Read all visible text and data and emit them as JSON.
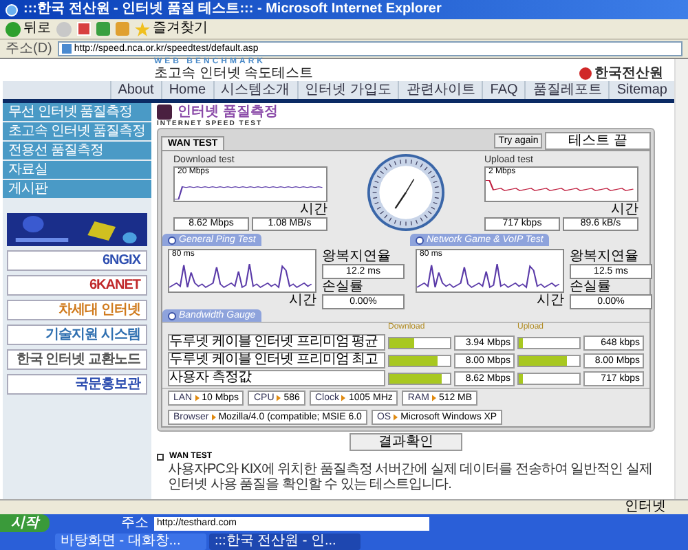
{
  "window": {
    "title": ":::한국 전산원 - 인터넷 품질 테스트::: - Microsoft Internet Explorer"
  },
  "toolbar": {
    "back": "뒤로",
    "favorites": "즐겨찾기"
  },
  "address_bar": {
    "label": "주소(D)",
    "url": "http://speed.nca.or.kr/speedtest/default.asp"
  },
  "site_header": {
    "tagline": "WEB BENCHMARK",
    "title": "초고속 인터넷 속도테스트",
    "logo": "한국전산원"
  },
  "nav": [
    "About",
    "Home",
    "시스템소개",
    "인터넷 가입도",
    "관련사이트",
    "FAQ",
    "품질레포트",
    "Sitemap"
  ],
  "sidebar": {
    "menu": [
      "무선 인터넷 품질측정",
      "초고속 인터넷 품질측정",
      "전용선 품질측정",
      "자료실",
      "게시판"
    ],
    "banners": [
      {
        "kind": "picture"
      },
      {
        "kind": "text",
        "label": "6NGIX",
        "color": "#2f4fb0"
      },
      {
        "kind": "text",
        "label": "6KANET",
        "color": "#c0282a"
      },
      {
        "kind": "text",
        "label": "차세대 인터넷",
        "color": "#d07a1c"
      },
      {
        "kind": "text",
        "label": "기술지원 시스템",
        "color": "#2f6fb0"
      },
      {
        "kind": "text",
        "label": "한국 인터넷 교환노드",
        "color": "#555555"
      },
      {
        "kind": "text",
        "label": "국문홍보관",
        "color": "#2f4fb0"
      }
    ]
  },
  "main": {
    "title": "인터넷 품질측정",
    "subtitle": "INTERNET SPEED TEST",
    "tab": "WAN TEST",
    "try_again": "Try again",
    "status": "테스트 끝",
    "download": {
      "label": "Download test",
      "scale": "20 Mbps",
      "axis": "시간",
      "values": [
        "8.62 Mbps",
        "1.08 MB/s"
      ]
    },
    "upload": {
      "label": "Upload test",
      "scale": "2 Mbps",
      "axis": "시간",
      "values": [
        "717 kbps",
        "89.6 kB/s"
      ]
    },
    "ping": [
      {
        "title": "General Ping Test",
        "scale": "80 ms",
        "axis": "시간",
        "rtt_label": "왕복지연율",
        "rtt": "12.2 ms",
        "loss_label": "손실률",
        "loss": "0.00%"
      },
      {
        "title": "Network Game & VoIP Test",
        "scale": "80 ms",
        "axis": "시간",
        "rtt_label": "왕복지연율",
        "rtt": "12.5 ms",
        "loss_label": "손실률",
        "loss": "0.00%"
      }
    ],
    "bandwidth": {
      "title": "Bandwidth Gauge",
      "download_label": "Download",
      "upload_label": "Upload",
      "rows": [
        {
          "label": "두루넷 케이블 인터넷 프리미엄 평균",
          "download": {
            "value": "3.94 Mbps",
            "level": 0.42
          },
          "upload": {
            "value": "648 kbps",
            "level": 0.06
          }
        },
        {
          "label": "두루넷 케이블 인터넷 프리미엄 최고",
          "download": {
            "value": "8.00 Mbps",
            "level": 0.8
          },
          "upload": {
            "value": "8.00 Mbps",
            "level": 0.8
          }
        },
        {
          "label": "사용자 측정값",
          "download": {
            "value": "8.62 Mbps",
            "level": 0.86
          },
          "upload": {
            "value": "717 kbps",
            "level": 0.07
          }
        }
      ]
    },
    "system": [
      {
        "label": "LAN",
        "value": "10 Mbps"
      },
      {
        "label": "CPU",
        "value": "586"
      },
      {
        "label": "Clock",
        "value": "1005 MHz"
      },
      {
        "label": "RAM",
        "value": "512 MB"
      },
      {
        "label": "Browser",
        "value": "Mozilla/4.0 (compatible; MSIE 6.0"
      },
      {
        "label": "OS",
        "value": "Microsoft Windows XP"
      }
    ],
    "result_button": "결과확인",
    "info": {
      "heading": "WAN TEST",
      "text": "사용자PC와 KIX에 위치한 품질측정 서버간에 실제 데이터를 전송하여 일반적인 실제 인터넷 사용 품질을 확인할 수 있는 테스트입니다."
    }
  },
  "status_bar": {
    "zone": "인터넷"
  },
  "taskbar": {
    "start": "시작",
    "address_label": "주소",
    "address": "http://testhard.com",
    "tasks": [
      {
        "label": "바탕화면 - 대화창...",
        "selected": false
      },
      {
        "label": ":::한국 전산원 - 인...",
        "selected": true
      }
    ]
  }
}
